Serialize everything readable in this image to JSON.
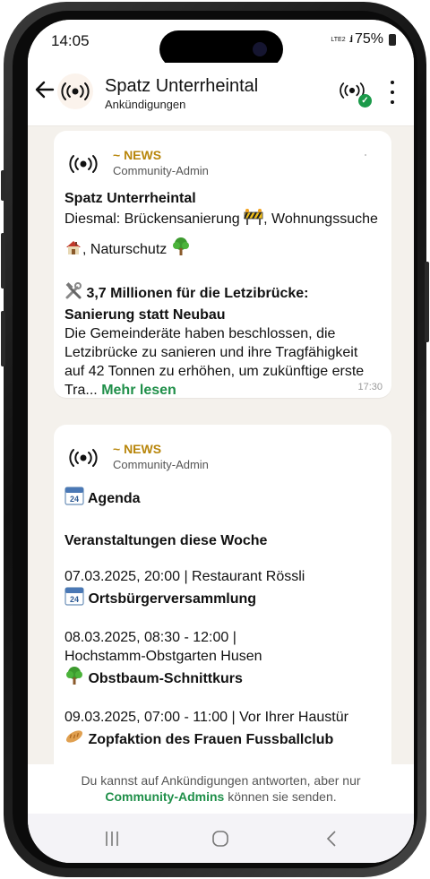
{
  "status_bar": {
    "time": "14:05",
    "network": "LTE2",
    "signal": ".ıl",
    "battery": "75%"
  },
  "header": {
    "title": "Spatz Unterrheintal",
    "subtitle": "Ankündigungen"
  },
  "messages": [
    {
      "channel": "~ NEWS",
      "author": "Community-Admin",
      "heading": "Spatz Unterrheintal",
      "line1_a": "Diesmal: Brückensanierung",
      "line1_b": ", Wohnungssuche",
      "line2": ", Naturschutz",
      "article_title": "3,7 Millionen für die Letzibrücke: Sanierung statt Neubau",
      "article_text": "Die Gemeinderäte haben beschlossen, die Letzibrücke zu sanieren und ihre Tragfähigkeit auf 42 Tonnen zu erhöhen, um zukünftige erste Tra...",
      "more": "Mehr lesen",
      "time": "17:30"
    },
    {
      "channel": "~ NEWS",
      "author": "Community-Admin",
      "heading": "Agenda",
      "subheading": "Veranstaltungen diese Woche",
      "events": [
        {
          "when": "07.03.2025, 20:00 | Restaurant Rössli",
          "when2": "",
          "name": "Ortsbürgerversammlung",
          "icon": "calendar-icon"
        },
        {
          "when": "08.03.2025, 08:30 - 12:00 |",
          "when2": "Hochstamm-Obstgarten Husen",
          "name": "Obstbaum-Schnittkurs",
          "icon": "tree-icon"
        },
        {
          "when": "09.03.2025, 07:00 - 11:00 | Vor Ihrer Haustür",
          "when2": "",
          "name": "Zopfaktion des Frauen Fussballclub",
          "icon": "bread-icon"
        }
      ]
    }
  ],
  "footer": {
    "notice_a": "Du kannst auf Ankündigungen antworten, aber nur",
    "notice_link": "Community-Admins",
    "notice_b": " können sie senden."
  },
  "colors": {
    "accent": "#1f8f49",
    "news": "#b8860b",
    "chat_bg": "#f4f1ec"
  }
}
